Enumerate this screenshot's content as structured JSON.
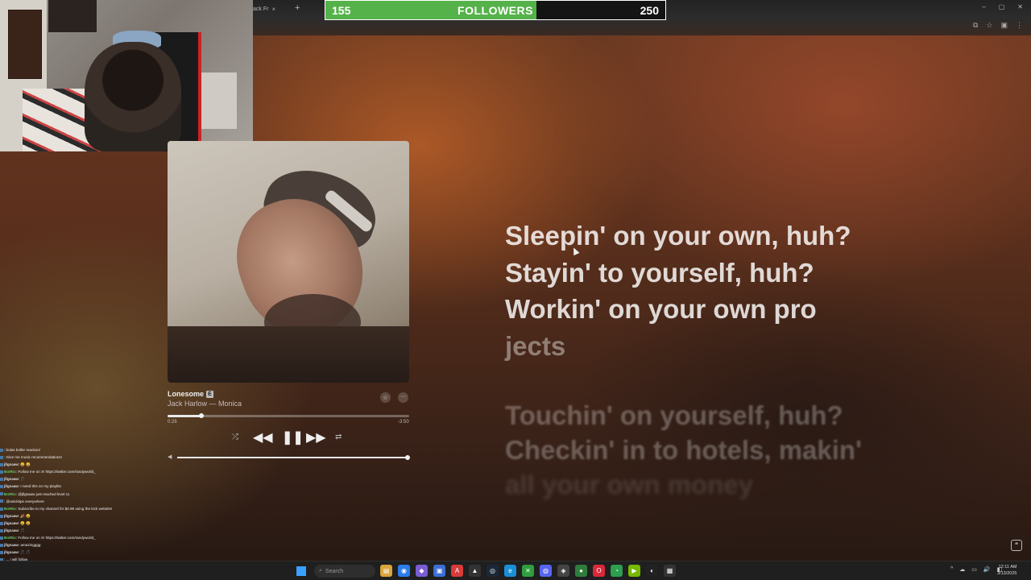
{
  "browser": {
    "tab_title": "ack Fr",
    "tab_close": "×",
    "new_tab": "+",
    "window_controls": [
      "–",
      "▢",
      "✕"
    ],
    "toolbar_icons": [
      "⧉",
      "☆",
      "▣",
      "⋮"
    ]
  },
  "followers_goal": {
    "current": "155",
    "label": "FOLLOWERS",
    "goal": "250",
    "progress_fraction": 0.62,
    "fill_color": "#55b24a"
  },
  "player": {
    "title": "Lonesome",
    "explicit_badge": "E",
    "artist_album": "Jack Harlow — Monica",
    "elapsed": "0:26",
    "remaining": "-3:50",
    "progress_fraction": 0.14,
    "volume_fraction": 1.0,
    "star_glyph": "☆",
    "more_glyph": "···",
    "shuffle_glyph": "⤮",
    "prev_glyph": "◀◀",
    "play_glyph": "❚❚",
    "next_glyph": "▶▶",
    "repeat_glyph": "⇄",
    "volume_glyph": "◀"
  },
  "lyrics": {
    "current": [
      "Sleepin' on your own, huh?",
      "Stayin' to yourself, huh?",
      "Workin' on your own pro"
    ],
    "current_unsung": "jects",
    "upcoming": [
      "Touchin' on yourself, huh?",
      "Checkin' in to hotels, makin'",
      "all your own money"
    ],
    "lyrics_toggle_glyph": "❝"
  },
  "chat": [
    {
      "user": "",
      "color": "#e33",
      "text": ": bolas boller reaction/"
    },
    {
      "user": "",
      "color": "#e33",
      "text": ": Give me music recommendations!"
    },
    {
      "user": "jllgsaaw",
      "color": "#ddd",
      "text": ": 😀 😀"
    },
    {
      "user": "BotRix",
      "color": "#6c6",
      "text": ": Follow me on X! https://twitter.com/randyworld_"
    },
    {
      "user": "jllgsaaw",
      "color": "#ddd",
      "text": ": 🎵"
    },
    {
      "user": "jllgsaaw",
      "color": "#ddd",
      "text": ": I need this on my playlist"
    },
    {
      "user": "BotRix",
      "color": "#6c6",
      "text": ": @jllgsaaw just reached level 11"
    },
    {
      "user": "",
      "color": "#e33",
      "text": ": @asicktips everywhere"
    },
    {
      "user": "BotRix",
      "color": "#6c6",
      "text": ": Subscribe to my channel for $4.99 using the kick website!"
    },
    {
      "user": "jllgsaaw",
      "color": "#ddd",
      "text": ": 🎉 😀"
    },
    {
      "user": "jllgsaaw",
      "color": "#ddd",
      "text": ": 😀 😀"
    },
    {
      "user": "jllgsaaw",
      "color": "#ddd",
      "text": ": 🎵"
    },
    {
      "user": "BotRix",
      "color": "#6c6",
      "text": ": Follow me on X! https://twitter.com/randyworld_"
    },
    {
      "user": "jllgsaaw",
      "color": "#ddd",
      "text": ": amazingggg"
    },
    {
      "user": "jllgsaaw",
      "color": "#ddd",
      "text": ": 🎵 🎵"
    },
    {
      "user": "",
      "color": "#e33",
      "text": ": ... i will follow"
    },
    {
      "user": "BotRix",
      "color": "#6c6",
      "text": ": Follow me on X! https://twitter.com/randyworld_"
    }
  ],
  "taskbar": {
    "search_placeholder": "Search",
    "search_glyph": "⌕",
    "start_label": "Start",
    "apps": [
      {
        "name": "file-explorer-icon",
        "glyph": "▤",
        "color": "#d9a43a"
      },
      {
        "name": "browser-icon",
        "glyph": "◉",
        "color": "#2b7de9"
      },
      {
        "name": "app-icon",
        "glyph": "◆",
        "color": "#7a5cd6"
      },
      {
        "name": "app-icon",
        "glyph": "▣",
        "color": "#3b6fd6"
      },
      {
        "name": "adobe-icon",
        "glyph": "A",
        "color": "#d93a3a"
      },
      {
        "name": "app-icon",
        "glyph": "▲",
        "color": "#333"
      },
      {
        "name": "steam-icon",
        "glyph": "◎",
        "color": "#1b2838"
      },
      {
        "name": "edge-icon",
        "glyph": "e",
        "color": "#1a8fd6"
      },
      {
        "name": "xbox-icon",
        "glyph": "✕",
        "color": "#2e9e3e"
      },
      {
        "name": "discord-icon",
        "glyph": "◍",
        "color": "#5865f2"
      },
      {
        "name": "app-icon",
        "glyph": "◈",
        "color": "#444"
      },
      {
        "name": "app-icon",
        "glyph": "●",
        "color": "#2f7d3a"
      },
      {
        "name": "opera-icon",
        "glyph": "O",
        "color": "#d9293a"
      },
      {
        "name": "chrome-icon",
        "glyph": "◔",
        "color": "#2d9f4f"
      },
      {
        "name": "nvidia-icon",
        "glyph": "▶",
        "color": "#76b900"
      },
      {
        "name": "app-icon",
        "glyph": "◐",
        "color": "#222"
      },
      {
        "name": "app-icon",
        "glyph": "▦",
        "color": "#333"
      }
    ],
    "tray_glyphs": [
      "^",
      "☁",
      "▭",
      "🔊",
      "◧"
    ],
    "time": "12:11 AM",
    "date": "3/13/2025"
  }
}
